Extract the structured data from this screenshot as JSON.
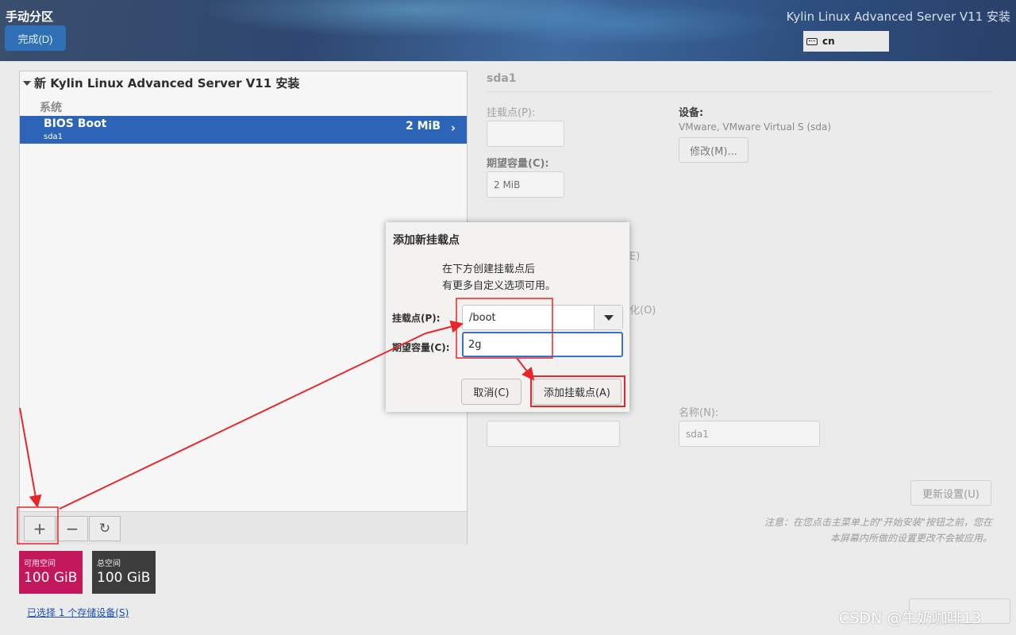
{
  "header": {
    "page_title": "手动分区",
    "done_button": "完成(D)",
    "product_title": "Kylin Linux Advanced Server V11 安装",
    "keyboard_layout": "cn"
  },
  "left_panel": {
    "install_title": "新 Kylin Linux Advanced Server V11 安装",
    "section_label": "系统",
    "partitions": [
      {
        "name": "BIOS Boot",
        "device": "sda1",
        "size": "2 MiB",
        "selected": true
      }
    ],
    "toolbar": {
      "add_icon": "+",
      "remove_icon": "−",
      "refresh_icon": "↻"
    },
    "available_space": {
      "label": "可用空间",
      "value": "100 GiB",
      "color": "#c2185b"
    },
    "total_space": {
      "label": "总空间",
      "value": "100 GiB",
      "color": "#3c3c3c"
    },
    "storage_link": "已选择 1 个存储设备(S)"
  },
  "right_panel": {
    "title": "sda1",
    "mount_point_label": "挂载点(P):",
    "mount_point_value": "",
    "desired_capacity_label": "期望容量(C):",
    "desired_capacity_value": "2 MiB",
    "device_label": "设备:",
    "device_value": "VMware, VMware Virtual S (sda)",
    "modify_button": "修改(M)...",
    "partial_text_1": "E)",
    "partial_text_2": "化(O)",
    "name_label": "名称(N):",
    "name_value": "sda1",
    "update_button": "更新设置(U)",
    "note_line1": "注意：在您点击主菜单上的\"开始安装\"按钮之前，您在",
    "note_line2": "本屏幕内所做的设置更改不会被应用。"
  },
  "dialog": {
    "title": "添加新挂载点",
    "desc_line1": "在下方创建挂载点后",
    "desc_line2": "有更多自定义选项可用。",
    "mount_label": "挂载点(P):",
    "mount_value": "/boot",
    "capacity_label": "期望容量(C):",
    "capacity_value": "2g",
    "cancel_button": "取消(C)",
    "add_button": "添加挂载点(A)"
  },
  "watermark": "CSDN @牛奶咖啡13",
  "colors": {
    "accent": "#2c64b7",
    "annotation": "#e8262a"
  }
}
